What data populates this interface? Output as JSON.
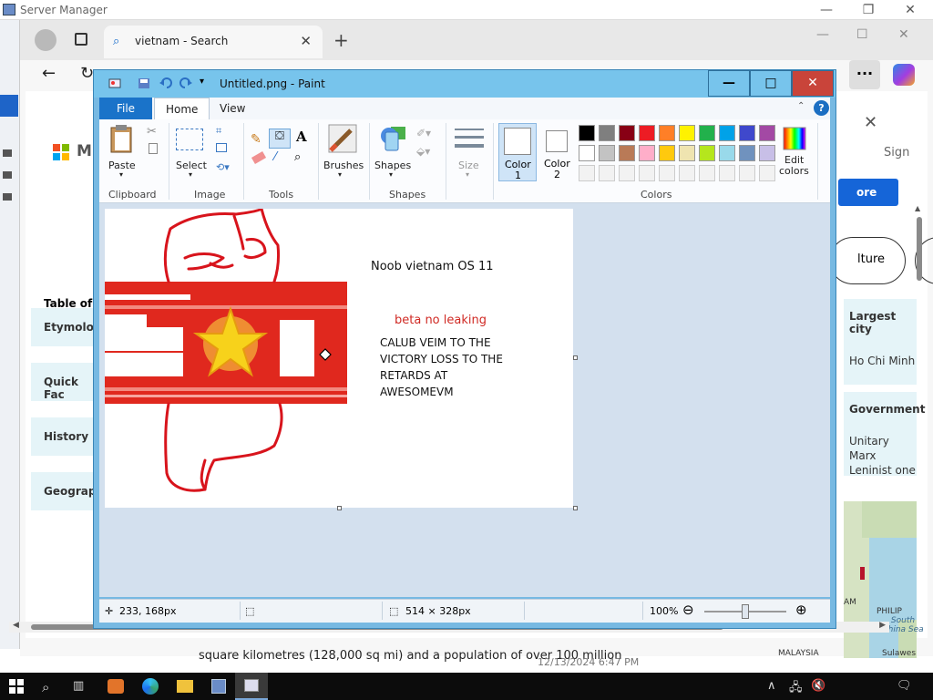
{
  "server_manager": {
    "title": "Server Manager",
    "min": "—",
    "max": "❐",
    "close": "✕"
  },
  "browser": {
    "tab_label": "vietnam - Search",
    "tab_icon": "search-icon",
    "newtab": "+",
    "min": "—",
    "max": "☐",
    "close": "✕",
    "back": "←",
    "more": "···",
    "page": {
      "logo_text": "Mic",
      "sign_in": "Sign",
      "more_button": "ore",
      "culture_pill": "lture",
      "toc_title": "Table of C",
      "toc_items": [
        "Etymology",
        "Quick Fac",
        "History",
        "Geography"
      ],
      "facts": [
        {
          "heading": "Largest city",
          "value": "Ho Chi Minh"
        },
        {
          "heading": "Government",
          "value": "Unitary Marx Leninist one"
        }
      ],
      "map_labels": {
        "sea": "South China Sea",
        "am": "AM",
        "philippines": "PHILIP",
        "malaysia": "MALAYSIA",
        "sulawesi": "Sulawes"
      },
      "bottom_text": "square kilometres (128,000 sq mi) and a population of over 100 million",
      "clock_ghost": "12/13/2024 6:47 PM"
    }
  },
  "paint": {
    "title": "Untitled.png - Paint",
    "controls": {
      "min": "—",
      "max": "□",
      "close": "✕"
    },
    "tabs": {
      "file": "File",
      "home": "Home",
      "view": "View"
    },
    "ribbon": {
      "paste": "Paste",
      "select": "Select",
      "brushes": "Brushes",
      "shapes": "Shapes",
      "size": "Size",
      "color1": "Color\n1",
      "color1_a": "Color",
      "color1_b": "1",
      "color2_a": "Color",
      "color2_b": "2",
      "edit_a": "Edit",
      "edit_b": "colors",
      "groups": [
        "Clipboard",
        "Image",
        "Tools",
        "Shapes",
        "Colors"
      ]
    },
    "palette_row1": [
      "#000000",
      "#7f7f7f",
      "#880015",
      "#ed1c24",
      "#ff7f27",
      "#fff200",
      "#22b14c",
      "#00a2e8",
      "#3f48cc",
      "#a349a4"
    ],
    "palette_row2": [
      "#ffffff",
      "#c3c3c3",
      "#b97a57",
      "#ffaec9",
      "#ffc90e",
      "#efe4b0",
      "#b5e61d",
      "#99d9ea",
      "#7092be",
      "#c8bfe7"
    ],
    "canvas_text": {
      "title_line": "Noob vietnam OS 11",
      "beta": "beta no leaking",
      "line1": "CALUB VEIM TO THE",
      "line2": "VICTORY LOSS TO THE",
      "line3": "RETARDS AT",
      "line4": "AWESOMEVM"
    },
    "status": {
      "cursor_pos": "233, 168px",
      "image_size": "514 × 328px",
      "zoom": "100%",
      "zoom_level": 0.5
    }
  },
  "colors": {
    "paint_accent": "#1a73c9",
    "paint_title": "#77c4ec",
    "flag_red": "#e0281e",
    "star_yellow": "#f7d21b",
    "pen_red": "#d8141c"
  },
  "taskbar": {
    "items": [
      "start-icon",
      "search-icon",
      "task-view-icon",
      "fox-app-icon",
      "edge-icon",
      "file-explorer-icon",
      "server-manager-icon",
      "paint-icon"
    ]
  }
}
